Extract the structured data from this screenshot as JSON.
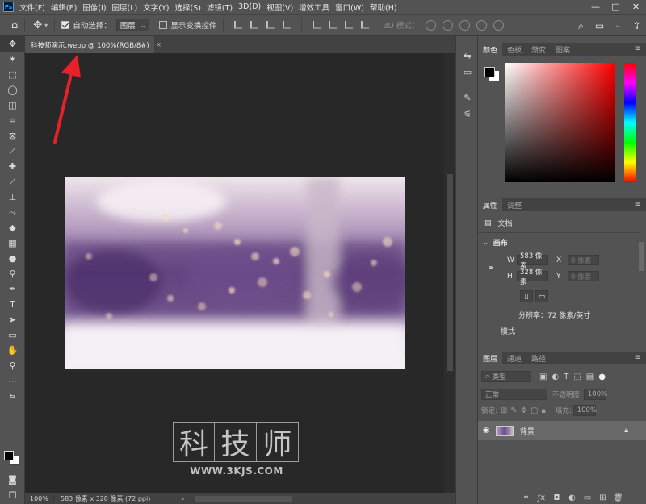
{
  "app": {
    "logo_text": "Ps"
  },
  "menu": [
    "文件(F)",
    "编辑(E)",
    "图像(I)",
    "图层(L)",
    "文字(Y)",
    "选择(S)",
    "滤镜(T)",
    "3D(D)",
    "视图(V)",
    "增效工具",
    "窗口(W)",
    "帮助(H)"
  ],
  "window_controls": {
    "minimize": "—",
    "maximize": "□",
    "close": "✕"
  },
  "options": {
    "auto_select_label": "自动选择：",
    "auto_select_checked": true,
    "layer_select_value": "图层",
    "show_transform_label": "显示变换控件",
    "show_transform_checked": false,
    "mode_3d_label": "3D 模式："
  },
  "document": {
    "tab_title": "科技师演示.webp @ 100%(RGB/8#)",
    "tab_close": "×",
    "zoom": "100%",
    "status_info": "583 像素 x 328 像素 (72 ppi)",
    "status_arrow": "›",
    "annotation_arrow_color": "#e8202a"
  },
  "watermark": {
    "chars": [
      "科",
      "技",
      "师"
    ],
    "url": "WWW.3KJS.COM"
  },
  "color_panel": {
    "tabs": [
      "颜色",
      "色板",
      "渐变",
      "图案"
    ],
    "fg_color": "#000000",
    "bg_color": "#ffffff",
    "hue_color": "#ff0000"
  },
  "properties_panel": {
    "tabs": [
      "属性",
      "调整"
    ],
    "doc_label": "文档",
    "section": "画布",
    "w_label": "W",
    "w_value": "583 像素",
    "x_label": "X",
    "x_placeholder": "0 像素",
    "h_label": "H",
    "h_value": "328 像素",
    "y_label": "Y",
    "y_placeholder": "0 像素",
    "resolution": "分辨率：72 像素/英寸",
    "mode_label": "模式"
  },
  "layers_panel": {
    "tabs": [
      "图层",
      "通道",
      "路径"
    ],
    "filter_type": "类型",
    "blend_mode": "正常",
    "opacity_label": "不透明度:",
    "opacity_value": "100%",
    "lock_label": "锁定:",
    "fill_label": "填充:",
    "fill_value": "100%",
    "layer_name": "背景"
  }
}
